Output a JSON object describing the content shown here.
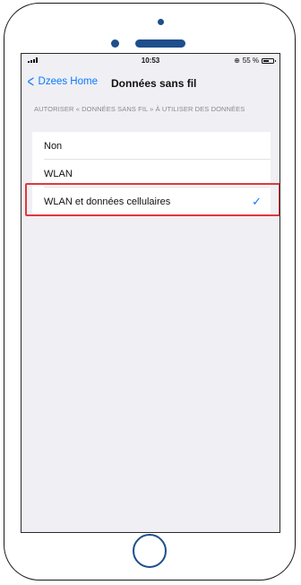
{
  "status_bar": {
    "time": "10:53",
    "battery_text": "55 %"
  },
  "nav": {
    "back_label": "Dzees Home",
    "title": "Données sans fil"
  },
  "section": {
    "header": "AUTORISER « DONNÉES SANS FIL » À UTILISER DES DONNÉES"
  },
  "options": [
    {
      "label": "Non",
      "selected": false
    },
    {
      "label": "WLAN",
      "selected": false
    },
    {
      "label": "WLAN et données cellulaires",
      "selected": true
    }
  ],
  "colors": {
    "accent": "#0a7aff",
    "highlight": "#e0383e",
    "device": "#1f4e8c"
  }
}
